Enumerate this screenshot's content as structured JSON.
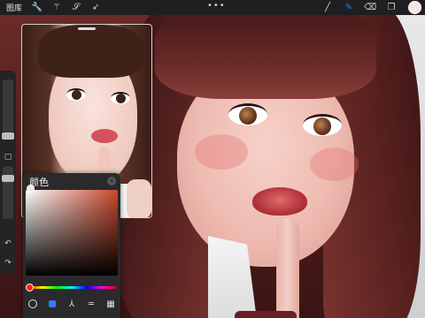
{
  "topbar": {
    "gallery_label": "图库",
    "left_tools": [
      "wrench-icon",
      "magic-wand-icon",
      "selection-s-icon",
      "transform-arrow-icon"
    ],
    "more_label": "•••",
    "right_tools": [
      "brush-icon",
      "smudge-icon",
      "eraser-icon",
      "layers-icon"
    ],
    "active_tool": "smudge-icon",
    "current_color": "#f8e6e4"
  },
  "sidebar": {
    "items": [
      "brush-size-slider",
      "modify-button",
      "opacity-slider",
      "undo-button",
      "redo-button"
    ]
  },
  "color_panel": {
    "title": "颜色",
    "close_glyph": "×",
    "tabs": [
      "disc",
      "classic",
      "harmony",
      "value",
      "palettes"
    ],
    "active_tab": "classic",
    "hue_color": "#c8472c"
  },
  "colors": {
    "accent": "#2f7cff",
    "toolbar_bg": "#1f1f21",
    "panel_bg": "#2a2a2c"
  }
}
